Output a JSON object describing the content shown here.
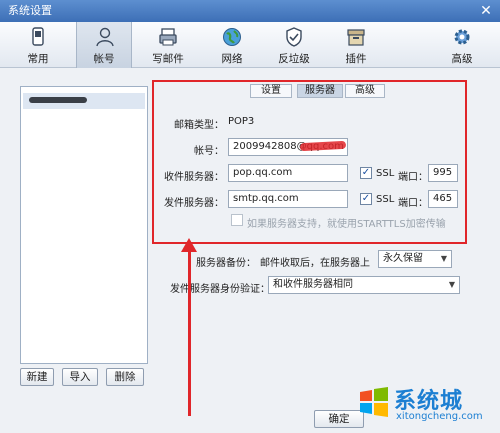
{
  "window": {
    "title": "系统设置",
    "close_glyph": "✕"
  },
  "toolbar": {
    "items": [
      {
        "label": "常用",
        "icon": "phone-icon"
      },
      {
        "label": "帐号",
        "icon": "user-icon",
        "active": true
      },
      {
        "label": "写邮件",
        "icon": "compose-icon"
      },
      {
        "label": "网络",
        "icon": "globe-icon"
      },
      {
        "label": "反垃级",
        "icon": "shield-icon"
      },
      {
        "label": "插件",
        "icon": "box-icon"
      },
      {
        "label": "高级",
        "icon": "gear-icon"
      }
    ]
  },
  "account_list": {
    "buttons": {
      "new": "新建",
      "import": "导入",
      "delete": "删除"
    }
  },
  "tabs": [
    {
      "label": "设置"
    },
    {
      "label": "服务器",
      "active": true
    },
    {
      "label": "高级"
    }
  ],
  "server": {
    "mailbox_type_label": "邮箱类型：",
    "mailbox_type_value": "POP3",
    "account_label": "帐号：",
    "account_value": "2009942808@qq.com",
    "incoming_label": "收件服务器：",
    "incoming_value": "pop.qq.com",
    "incoming_ssl_label": "SSL",
    "incoming_port_label": "端口：",
    "incoming_port_value": "995",
    "outgoing_label": "发件服务器：",
    "outgoing_value": "smtp.qq.com",
    "outgoing_ssl_label": "SSL",
    "outgoing_port_label": "端口：",
    "outgoing_port_value": "465",
    "starttls_label": "如果服务器支持，就使用STARTTLS加密传输"
  },
  "backup": {
    "label": "服务器备份：",
    "text": "邮件收取后，在服务器上",
    "select_value": "永久保留"
  },
  "auth": {
    "label": "发件服务器身份验证：",
    "select_value": "和收件服务器相同"
  },
  "footer": {
    "ok_label": "确定"
  },
  "watermark": {
    "text": "系统城",
    "url": "xitongcheng.com"
  },
  "colors": {
    "accent": "#e0262a",
    "brand_blue": "#1c7fd2"
  }
}
